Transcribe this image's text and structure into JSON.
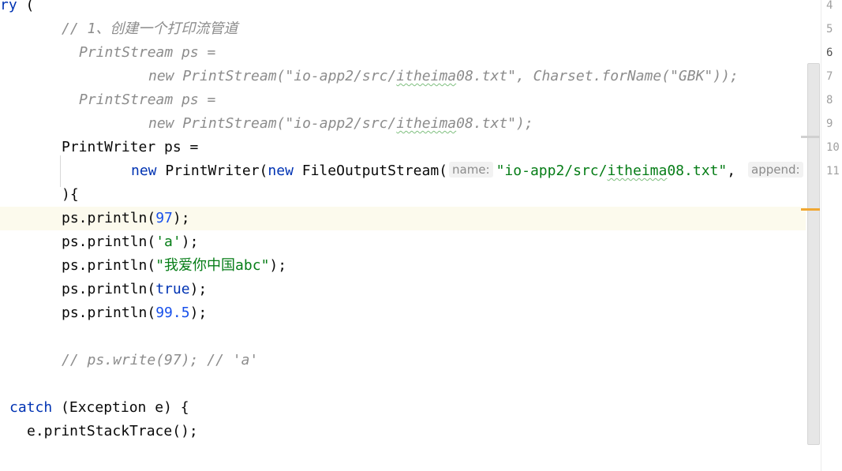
{
  "editor": {
    "lines": {
      "l0": {
        "kw": "ry",
        "punct": " ("
      },
      "l1": {
        "comment": "// 1、创建一个打印流管道"
      },
      "l2": {
        "comment": "PrintStream ps ="
      },
      "l3": {
        "c1": "new PrintStream(\"io-app2/src/",
        "c2": "itheima",
        "c3": "08.txt\", Charset.forName(\"GBK\"));"
      },
      "l4": {
        "comment": "PrintStream ps ="
      },
      "l5": {
        "c1": "new PrintStream(\"io-app2/src/",
        "c2": "itheima",
        "c3": "08.txt\");"
      },
      "l6": {
        "text": "PrintWriter ps ="
      },
      "l7": {
        "kw1": "new",
        "t1": " PrintWriter(",
        "kw2": "new",
        "t2": " FileOutputStream(",
        "hint_name": "name:",
        "s1": "\"io-app2/src/",
        "s2": "itheima",
        "s3": "08.txt\"",
        "t3": ",",
        "hint_append": "append:"
      },
      "l8": {
        "text": "){"
      },
      "l9": {
        "pre": "ps.println(",
        "num": "97",
        "post": ");"
      },
      "l10": {
        "pre": "ps.println(",
        "str": "'a'",
        "post": ");"
      },
      "l11": {
        "pre": "ps.println(",
        "str": "\"我爱你中国abc\"",
        "post": ");"
      },
      "l12": {
        "pre": "ps.println(",
        "kw": "true",
        "post": ");"
      },
      "l13": {
        "pre": "ps.println(",
        "num": "99.5",
        "post": ");"
      },
      "l15": {
        "comment": "// ps.write(97); // 'a'"
      },
      "l17": {
        "kw": "catch",
        "text": " (Exception e) {"
      },
      "l18": {
        "text": "e.printStackTrace();"
      }
    }
  },
  "gutter": {
    "numbers": [
      "4",
      "5",
      "6",
      "7",
      "8",
      "9",
      "10",
      "11"
    ]
  },
  "colors": {
    "keyword": "#0033b3",
    "number": "#1750eb",
    "string": "#067d17",
    "comment": "#8c8c8c",
    "current_line": "#fcfaed",
    "scroll_marker": "#f0a732"
  }
}
